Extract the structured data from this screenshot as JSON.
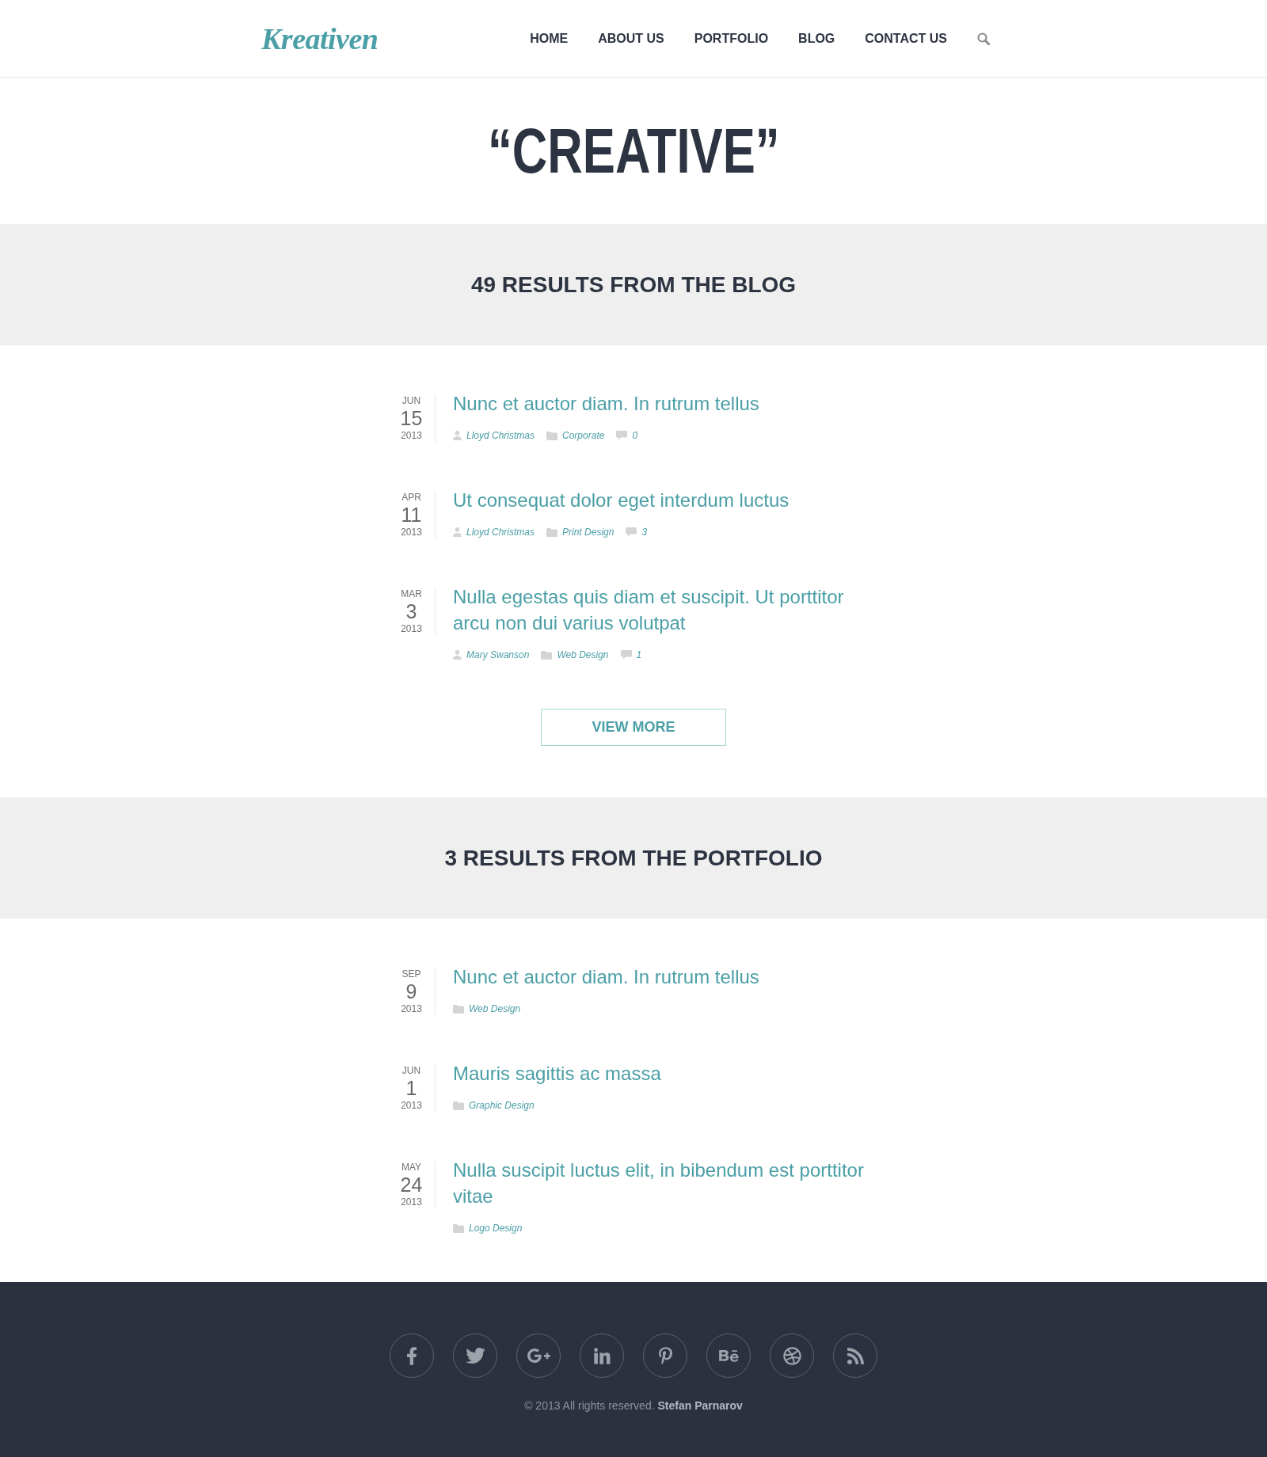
{
  "header": {
    "logo": "Kreativen",
    "nav": [
      {
        "label": "HOME",
        "selected": false
      },
      {
        "label": "ABOUT US",
        "selected": false
      },
      {
        "label": "PORTFOLIO",
        "selected": false
      },
      {
        "label": "BLOG",
        "selected": false
      },
      {
        "label": "CONTACT US",
        "selected": false
      }
    ]
  },
  "page_title": "“CREATIVE”",
  "sections": [
    {
      "heading": "49 RESULTS FROM THE BLOG",
      "results": [
        {
          "month": "JUN",
          "day": "15",
          "year": "2013",
          "title": "Nunc et auctor diam. In rutrum tellus",
          "author": "Lloyd Christmas",
          "category": "Corporate",
          "comments": "0"
        },
        {
          "month": "APR",
          "day": "11",
          "year": "2013",
          "title": "Ut consequat dolor eget interdum luctus",
          "author": "Lloyd Christmas",
          "category": "Print Design",
          "comments": "3"
        },
        {
          "month": "MAR",
          "day": "3",
          "year": "2013",
          "title": "Nulla egestas quis diam et suscipit. Ut porttitor arcu non dui varius volutpat",
          "author": "Mary Swanson",
          "category": "Web Design",
          "comments": "1"
        }
      ],
      "button": "VIEW MORE"
    },
    {
      "heading": "3 RESULTS FROM THE PORTFOLIO",
      "results": [
        {
          "month": "SEP",
          "day": "9",
          "year": "2013",
          "title": "Nunc et auctor diam. In rutrum tellus",
          "category": "Web Design"
        },
        {
          "month": "JUN",
          "day": "1",
          "year": "2013",
          "title": "Mauris sagittis ac massa",
          "category": "Graphic Design"
        },
        {
          "month": "MAY",
          "day": "24",
          "year": "2013",
          "title": "Nulla suscipit luctus elit, in bibendum est porttitor vitae",
          "category": "Logo Design"
        }
      ]
    }
  ],
  "footer": {
    "social": [
      {
        "kind": "facebook"
      },
      {
        "kind": "twitter"
      },
      {
        "kind": "google-plus"
      },
      {
        "kind": "linkedin"
      },
      {
        "kind": "pinterest"
      },
      {
        "kind": "behance"
      },
      {
        "kind": "dribbble"
      },
      {
        "kind": "rss"
      }
    ],
    "copyright": "© 2013 All rights reserved.",
    "author": "Stefan Parnarov"
  }
}
